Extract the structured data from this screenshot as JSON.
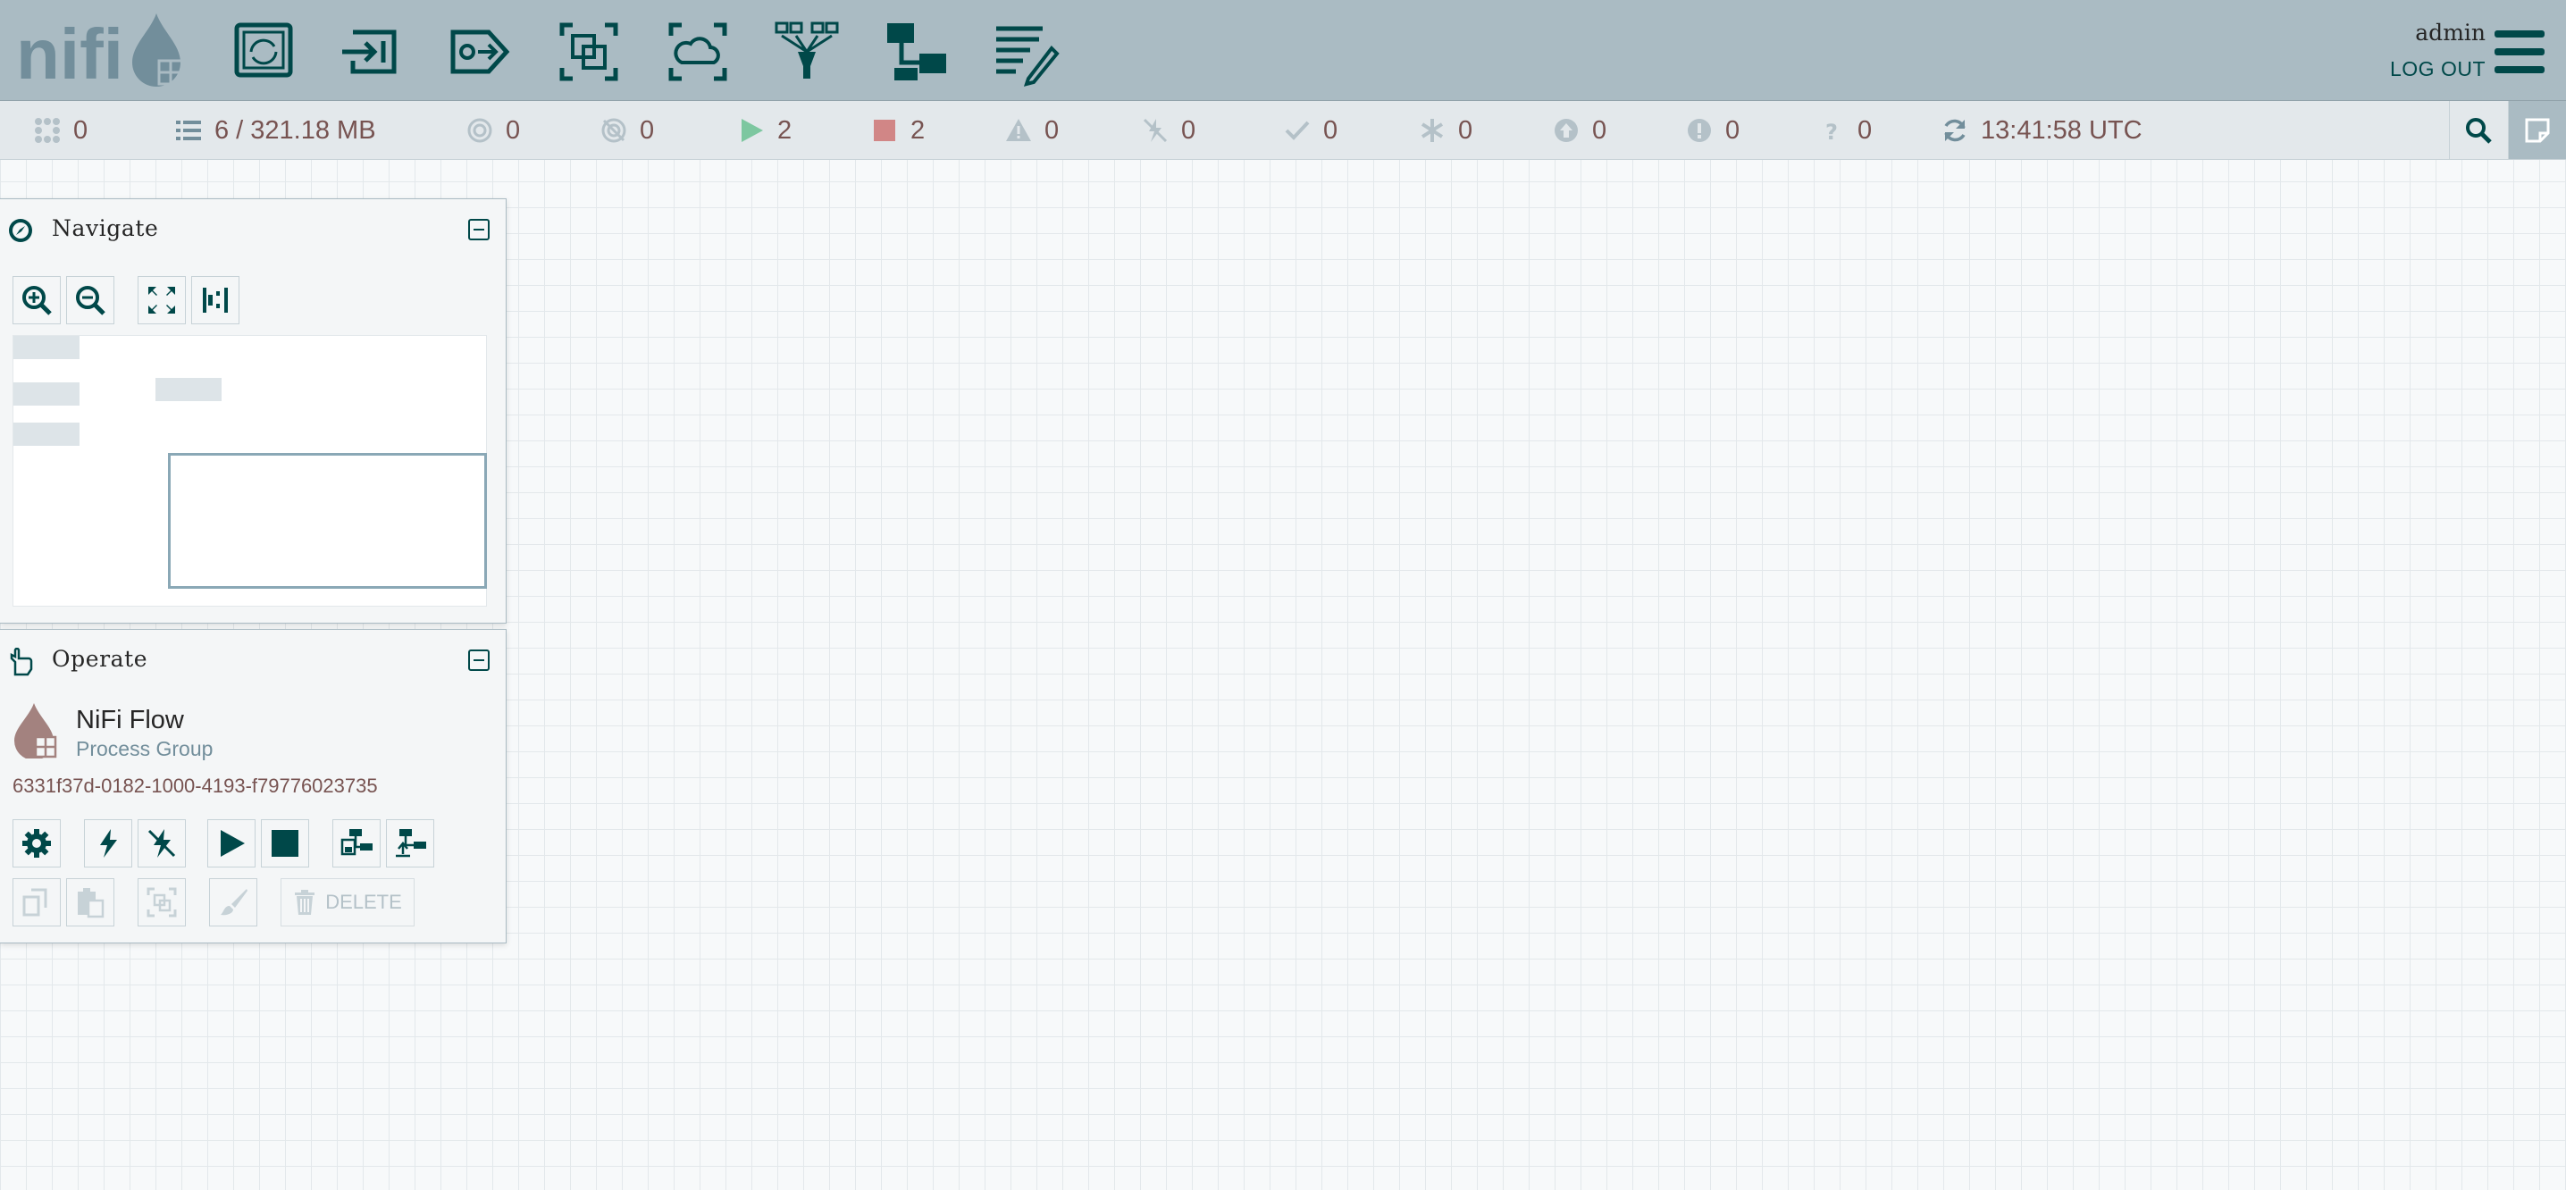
{
  "header": {
    "logo_text": "nifi",
    "toolbar": [
      {
        "name": "processor-icon",
        "tooltip": "Processor"
      },
      {
        "name": "input-port-icon",
        "tooltip": "Input Port"
      },
      {
        "name": "output-port-icon",
        "tooltip": "Output Port"
      },
      {
        "name": "process-group-icon",
        "tooltip": "Process Group"
      },
      {
        "name": "remote-process-group-icon",
        "tooltip": "Remote Process Group"
      },
      {
        "name": "funnel-icon",
        "tooltip": "Funnel"
      },
      {
        "name": "template-icon",
        "tooltip": "Template"
      },
      {
        "name": "label-icon",
        "tooltip": "Label"
      }
    ],
    "user": "admin",
    "logout_label": "LOG OUT"
  },
  "status": {
    "active_threads": "0",
    "queued": "6 / 321.18 MB",
    "transmitting": "0",
    "not_transmitting": "0",
    "running": "2",
    "stopped": "2",
    "invalid": "0",
    "disabled": "0",
    "up_to_date": "0",
    "locally_modified": "0",
    "stale": "0",
    "locally_modified_stale": "0",
    "sync_failure": "0",
    "refresh_time": "13:41:58 UTC",
    "colors": {
      "running": "#7dc7a0",
      "stopped": "#d18686"
    }
  },
  "navigate": {
    "title": "Navigate"
  },
  "operate": {
    "title": "Operate",
    "component_name": "NiFi Flow",
    "component_type": "Process Group",
    "component_id": "6331f37d-0182-1000-4193-f79776023735",
    "delete_label": "DELETE"
  }
}
